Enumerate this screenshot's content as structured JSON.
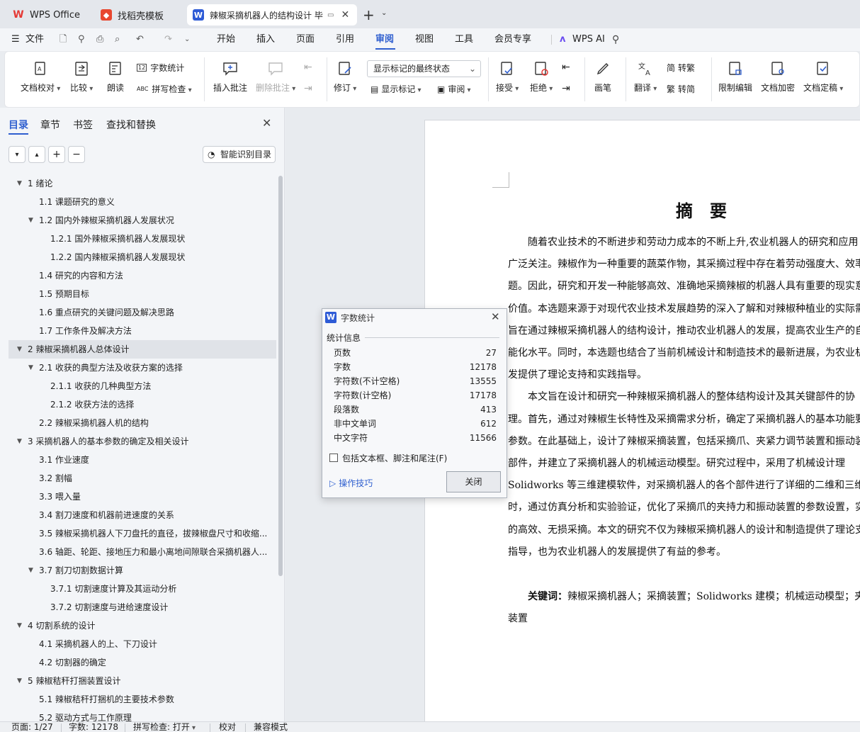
{
  "tabs": [
    {
      "label": "WPS Office",
      "icon": "wps-logo-icon"
    },
    {
      "label": "找稻壳模板",
      "icon": "docer-icon"
    },
    {
      "label": "辣椒采摘机器人的结构设计 毕",
      "icon": "word-doc-icon"
    }
  ],
  "menu": {
    "file": "文件",
    "items": [
      "开始",
      "插入",
      "页面",
      "引用",
      "审阅",
      "视图",
      "工具",
      "会员专享"
    ],
    "active": "审阅",
    "ai": "WPS AI"
  },
  "ribbon": {
    "doc_proof": "文档校对",
    "compare": "比较",
    "read": "朗读",
    "word_count": "字数统计",
    "spell": "拼写检查",
    "insert_comment": "插入批注",
    "delete_comment": "删除批注",
    "revise": "修订",
    "markup_state": "显示标记的最终状态",
    "show_markup": "显示标记",
    "review": "审阅",
    "accept": "接受",
    "reject": "拒绝",
    "pen": "画笔",
    "translate": "翻译",
    "to_trad": "转繁",
    "to_simp": "转简",
    "restrict": "限制编辑",
    "encrypt": "文档加密",
    "finalize": "文档定稿"
  },
  "side": {
    "tabs": [
      "目录",
      "章节",
      "书签",
      "查找和替换"
    ],
    "smart": "智能识别目录",
    "toc": [
      {
        "t": "1 绪论",
        "l": 1,
        "e": true
      },
      {
        "t": "1.1 课题研究的意义",
        "l": 2
      },
      {
        "t": "1.2 国内外辣椒采摘机器人发展状况",
        "l": 2,
        "e": true
      },
      {
        "t": "1.2.1 国外辣椒采摘机器人发展现状",
        "l": 3
      },
      {
        "t": "1.2.2 国内辣椒采摘机器人发展现状",
        "l": 3
      },
      {
        "t": "1.4 研究的内容和方法",
        "l": 2
      },
      {
        "t": "1.5 预期目标",
        "l": 2
      },
      {
        "t": "1.6 重点研究的关键问题及解决思路",
        "l": 2
      },
      {
        "t": "1.7 工作条件及解决方法",
        "l": 2
      },
      {
        "t": "2 辣椒采摘机器人总体设计",
        "l": 1,
        "e": true,
        "sel": true
      },
      {
        "t": "2.1 收获的典型方法及收获方案的选择",
        "l": 2,
        "e": true
      },
      {
        "t": "2.1.1 收获的几种典型方法",
        "l": 3
      },
      {
        "t": "2.1.2 收获方法的选择",
        "l": 3
      },
      {
        "t": "2.2 辣椒采摘机器人机的结构",
        "l": 2
      },
      {
        "t": "3 采摘机器人的基本参数的确定及相关设计",
        "l": 1,
        "e": true
      },
      {
        "t": "3.1 作业速度",
        "l": 2
      },
      {
        "t": "3.2 割幅",
        "l": 2
      },
      {
        "t": "3.3 喂入量",
        "l": 2
      },
      {
        "t": "3.4 割刀速度和机器前进速度的关系",
        "l": 2
      },
      {
        "t": "3.5 辣椒采摘机器人下刀盘托的直径，拔辣椒盘尺寸和收缩...",
        "l": 2
      },
      {
        "t": "3.6 轴距、轮距、接地压力和最小离地间隙联合采摘机器人...",
        "l": 2
      },
      {
        "t": "3.7 割刀切割数据计算",
        "l": 2,
        "e": true
      },
      {
        "t": "3.7.1 切割速度计算及其运动分析",
        "l": 3
      },
      {
        "t": "3.7.2 切割速度与进给速度设计",
        "l": 3
      },
      {
        "t": "4 切割系统的设计",
        "l": 1,
        "e": true
      },
      {
        "t": "4.1 采摘机器人的上、下刀设计",
        "l": 2
      },
      {
        "t": "4.2 切割器的确定",
        "l": 2
      },
      {
        "t": "5  辣椒秸秆打捆装置设计",
        "l": 1,
        "e": true
      },
      {
        "t": "5.1 辣椒秸秆打捆机的主要技术参数",
        "l": 2
      },
      {
        "t": "5.2 驱动方式与工作原理",
        "l": 2
      }
    ]
  },
  "doc": {
    "title": "摘　要",
    "lines": [
      "　　随着农业技术的不断进步和劳动力成本的不断上升,农业机器人的研究和应用",
      "广泛关注。辣椒作为一种重要的蔬菜作物，其采摘过程中存在着劳动强度大、效率",
      "题。因此，研究和开发一种能够高效、准确地采摘辣椒的机器人具有重要的现实意",
      "价值。本选题来源于对现代农业技术发展趋势的深入了解和对辣椒种植业的实际需",
      "旨在通过辣椒采摘机器人的结构设计，推动农业机器人的发展，提高农业生产的自",
      "能化水平。同时，本选题也结合了当前机械设计和制造技术的最新进展，为农业机",
      "发提供了理论支持和实践指导。",
      "　　本文旨在设计和研究一种辣椒采摘机器人的整体结构设计及其关键部件的协",
      "理。首先，通过对辣椒生长特性及采摘需求分析，确定了采摘机器人的基本功能要",
      "参数。在此基础上，设计了辣椒采摘装置，包括采摘爪、夹紧力调节装置和振动装",
      "部件，并建立了采摘机器人的机械运动模型。研究过程中，采用了机械设计理",
      "Solidworks 等三维建模软件，对采摘机器人的各个部件进行了详细的二维和三维",
      "时，通过仿真分析和实验验证，优化了采摘爪的夹持力和振动装置的参数设置，实",
      "的高效、无损采摘。本文的研究不仅为辣椒采摘机器人的设计和制造提供了理论支",
      "指导，也为农业机器人的发展提供了有益的参考。"
    ],
    "kw_label": "关键词：",
    "kw_text": "辣椒采摘机器人；采摘装置；Solidworks 建模；机械运动模型；夹",
    "kw_cont": "装置"
  },
  "dialog": {
    "title": "字数统计",
    "section": "统计信息",
    "rows": [
      {
        "k": "页数",
        "v": "27"
      },
      {
        "k": "字数",
        "v": "12178"
      },
      {
        "k": "字符数(不计空格)",
        "v": "13555"
      },
      {
        "k": "字符数(计空格)",
        "v": "17178"
      },
      {
        "k": "段落数",
        "v": "413"
      },
      {
        "k": "非中文单词",
        "v": "612"
      },
      {
        "k": "中文字符",
        "v": "11566"
      }
    ],
    "checkbox": "包括文本框、脚注和尾注(F)",
    "tips": "操作技巧",
    "close": "关闭"
  },
  "status": {
    "page": "页面: 1/27",
    "words": "字数: 12178",
    "spell": "拼写检查: 打开",
    "proof": "校对",
    "compat": "兼容模式"
  },
  "colors": {
    "accent": "#2f5fcf",
    "wps_red": "#e53935",
    "docer": "#e8472f",
    "word_blue": "#2e5bd6"
  }
}
